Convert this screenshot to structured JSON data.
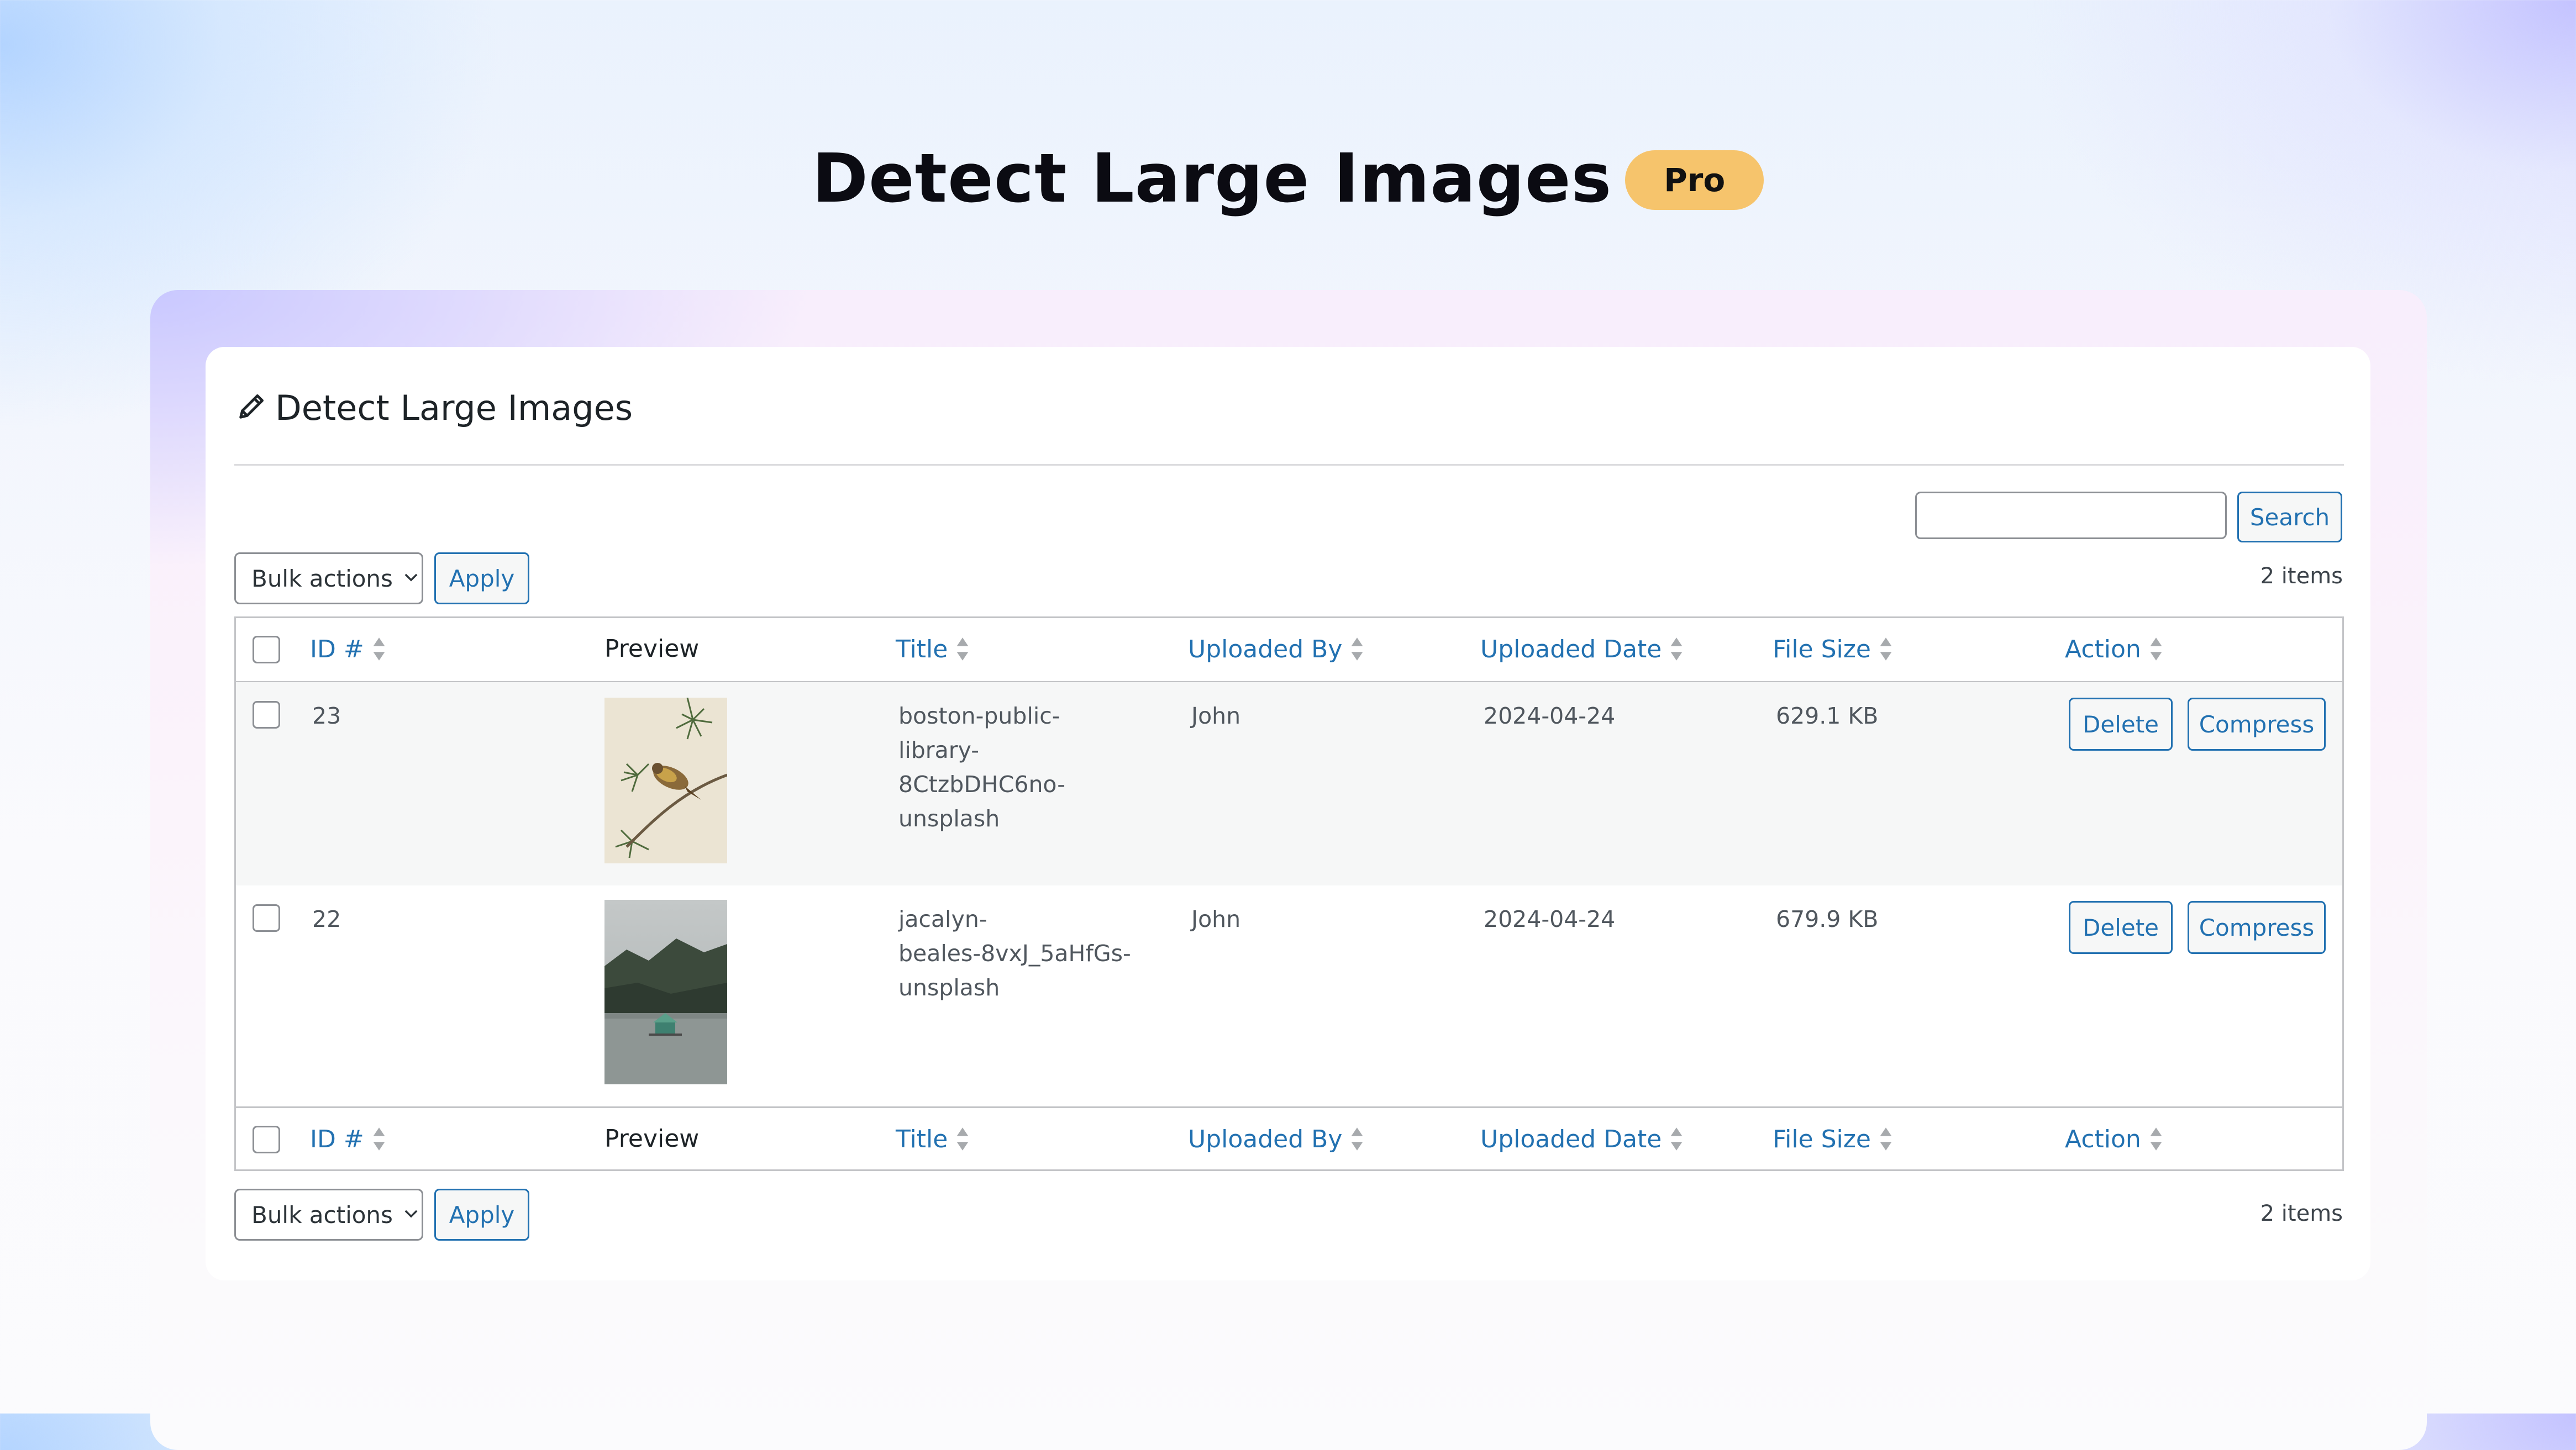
{
  "page": {
    "title": "Detect Large Images",
    "badge": "Pro"
  },
  "card": {
    "title": "Detect Large Images"
  },
  "search": {
    "placeholder": "",
    "button_label": "Search"
  },
  "bulk": {
    "select_value": "Bulk actions",
    "apply_label": "Apply",
    "count_text": "2 items"
  },
  "columns": {
    "id": "ID #",
    "preview": "Preview",
    "title": "Title",
    "uploaded_by": "Uploaded By",
    "uploaded_date": "Uploaded Date",
    "file_size": "File Size",
    "action": "Action"
  },
  "rows": [
    {
      "id": "23",
      "title": "boston-public-library-8CtzbDHC6no-unsplash",
      "title_lines": [
        "boston-public-",
        "library-8CtzbDHC6no-",
        "unsplash"
      ],
      "uploaded_by": "John",
      "uploaded_date": "2024-04-24",
      "file_size": "629.1 KB",
      "delete_label": "Delete",
      "compress_label": "Compress",
      "preview": "bird-on-branch-image"
    },
    {
      "id": "22",
      "title": "jacalyn-beales-8vxJ_5aHfGs-unsplash",
      "title_lines": [
        "jacalyn-",
        "beales-8vxJ_5aHfGs-",
        "unsplash"
      ],
      "uploaded_by": "John",
      "uploaded_date": "2024-04-24",
      "file_size": "679.9 KB",
      "delete_label": "Delete",
      "compress_label": "Compress",
      "preview": "lake-cabin-image"
    }
  ],
  "colors": {
    "accent": "#2271b1",
    "badge": "#f6c46c",
    "border": "#c3c4c7"
  },
  "icons": {
    "header": "pencil-icon",
    "sort": "sort-arrows-icon",
    "dropdown": "chevron-down-icon"
  }
}
